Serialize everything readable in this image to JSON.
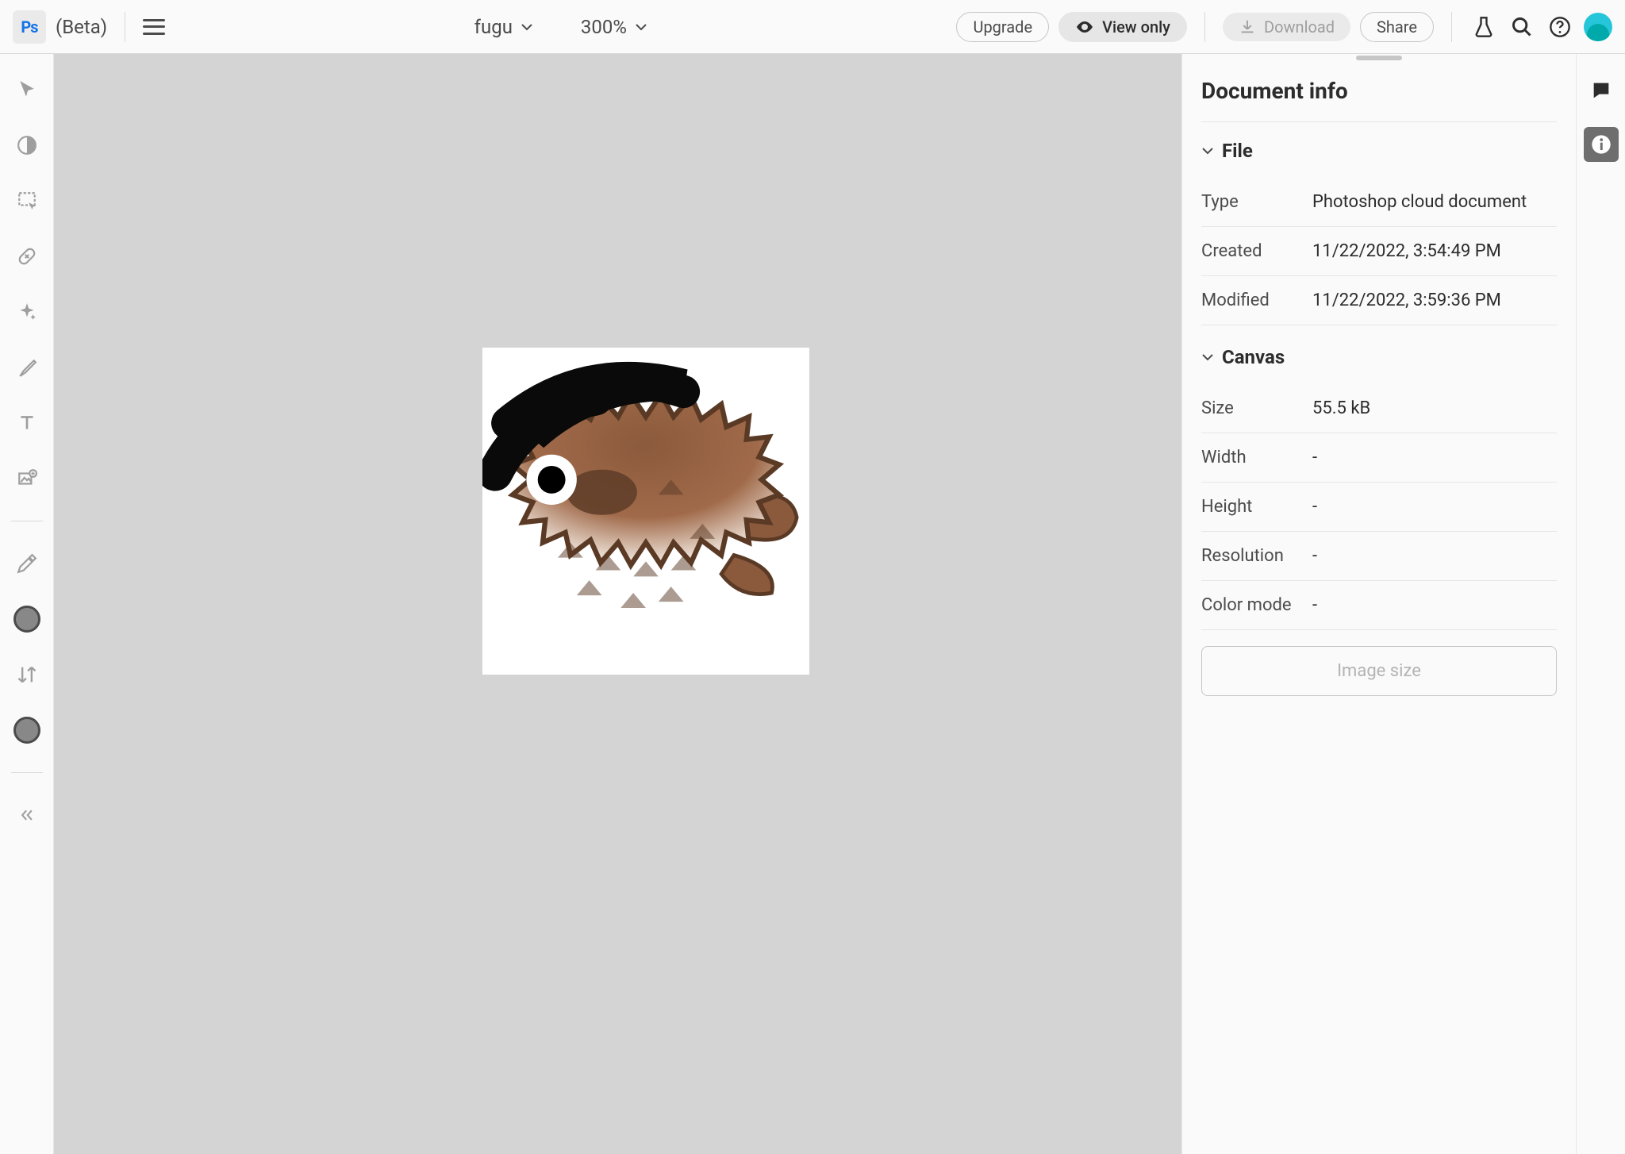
{
  "header": {
    "app_tag": "Ps",
    "beta_label": "(Beta)",
    "doc_name": "fugu",
    "zoom": "300%",
    "upgrade_label": "Upgrade",
    "view_only_label": "View only",
    "download_label": "Download",
    "share_label": "Share"
  },
  "panel": {
    "title": "Document info",
    "file": {
      "header": "File",
      "type_label": "Type",
      "type_value": "Photoshop cloud document",
      "created_label": "Created",
      "created_value": "11/22/2022, 3:54:49 PM",
      "modified_label": "Modified",
      "modified_value": "11/22/2022, 3:59:36 PM"
    },
    "canvas": {
      "header": "Canvas",
      "size_label": "Size",
      "size_value": "55.5 kB",
      "width_label": "Width",
      "width_value": "-",
      "height_label": "Height",
      "height_value": "-",
      "resolution_label": "Resolution",
      "resolution_value": "-",
      "colormode_label": "Color mode",
      "colormode_value": "-"
    },
    "image_size_label": "Image size"
  }
}
